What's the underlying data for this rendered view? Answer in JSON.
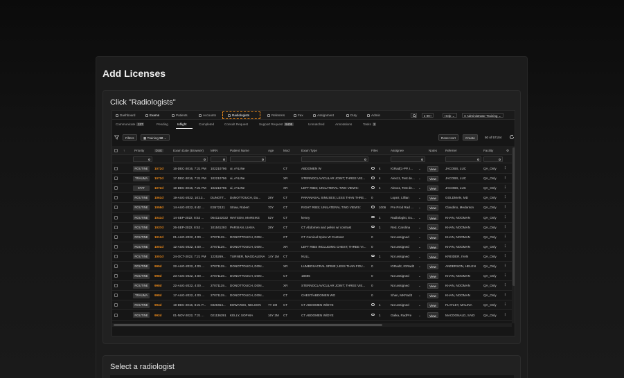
{
  "page": {
    "title": "Add Licenses",
    "step1_instruction": "Click \"Radiologists\"",
    "step2_instruction": "Select a radiologist"
  },
  "app": {
    "nav": [
      {
        "label": "Dashboard",
        "icon": "dashboard-icon"
      },
      {
        "label": "Exams",
        "icon": "exams-icon"
      },
      {
        "label": "Patients",
        "icon": "patients-icon"
      },
      {
        "label": "Accounts",
        "icon": "accounts-icon"
      },
      {
        "label": "Radiologists",
        "icon": "radiologists-icon"
      },
      {
        "label": "Referrers",
        "icon": "referrers-icon"
      },
      {
        "label": "Fax",
        "icon": "fax-icon"
      },
      {
        "label": "Assignment",
        "icon": "assignment-icon"
      },
      {
        "label": "Duty",
        "icon": "duty-icon"
      },
      {
        "label": "Admin",
        "icon": "admin-icon"
      }
    ],
    "notifications": "99+",
    "help_label": "Help",
    "user_label": "Administrator Training",
    "tabs": [
      {
        "label": "Communicate",
        "count": "137"
      },
      {
        "label": "Pending",
        "count": ""
      },
      {
        "label": "Inflight",
        "count": ""
      },
      {
        "label": "Completed",
        "count": ""
      },
      {
        "label": "Consult Request",
        "count": ""
      },
      {
        "label": "Support Request",
        "count": "9405"
      },
      {
        "label": "Unmatched",
        "count": ""
      },
      {
        "label": "Annotations",
        "count": ""
      },
      {
        "label": "Tasks",
        "count": "2"
      }
    ],
    "toolbar": {
      "filters_label": "Filters",
      "training_label": "Training",
      "training_count": "50",
      "reset_label": "Reset sort",
      "create_label": "Create",
      "paging": "50 of 57104"
    },
    "columns": [
      "Priority",
      "DUE",
      "Exam Date (Browser)",
      "MRN",
      "Patient Name",
      "Age",
      "Mod",
      "Exam Type",
      "Files",
      "Assignee",
      "Notes",
      "Referrer",
      "Facility"
    ],
    "rows": [
      {
        "priority": "ROUTINE",
        "due": "1072d",
        "date": "16-DEC-2016, 7:21 PM",
        "mrn": "102210796",
        "patient": "ui, AYLINe",
        "age": "",
        "mod": "CT",
        "exam": "ABDOMEN W",
        "files": "4",
        "assignee": "IGRad(1-PP, I...",
        "referrer": "JACOBS, LUC",
        "facility": "QA_Only"
      },
      {
        "priority": "TRAUMA",
        "due": "1072d",
        "date": "17-DEC-2016, 7:21 PM",
        "mrn": "102210796",
        "patient": "ui, AYLINe",
        "age": "",
        "mod": "XR",
        "exam": "STERNOCLAVICULAR JOINT; THREE VIE...",
        "files": "4",
        "assignee": "Alex11, Test de...",
        "referrer": "JACOBS, LUC",
        "facility": "QA_Only"
      },
      {
        "priority": "STAT",
        "due": "1072d",
        "date": "18-DEC-2016, 7:21 PM",
        "mrn": "102210796",
        "patient": "ui, AYLINe",
        "age": "",
        "mod": "XR",
        "exam": "LEFT RIBS; UNILATERAL TWO VIEWS:",
        "files": "4",
        "assignee": "Alex11, Test de...",
        "referrer": "JACOBS, LUC",
        "facility": "QA_Only"
      },
      {
        "priority": "ROUTINE",
        "due": "1061d",
        "date": "19-AUG-2022, 10:13...",
        "mrn": "DUNOTT...",
        "patient": "DoNOTTOUCH, Du...",
        "age": "28Y",
        "mod": "CT",
        "exam": "PARANASAL SINUSES; LESS THAN THRE...",
        "files": "0",
        "assignee": "Lopez, Lillian",
        "referrer": "GOLDMAN, MD",
        "facility": "QA_Only"
      },
      {
        "priority": "ROUTINE",
        "due": "1058d",
        "date": "14-AUG-2022, 8:42 ...",
        "mrn": "E3572121",
        "patient": "Straw, Robert",
        "age": "70Y",
        "mod": "CT",
        "exam": "RIGHT RIBS; UNILATERAL TWO VIEWS:",
        "files": "1006",
        "assignee": "Pre Prod Rad ...",
        "referrer": "Claudino, Medarson",
        "facility": "QA_Only"
      },
      {
        "priority": "ROUTINE",
        "due": "1041d",
        "date": "14-SEP-2022, 8:52 ...",
        "mrn": "0641142022",
        "patient": "WATSON, MAREIKE",
        "age": "52Y",
        "mod": "CT",
        "exam": "kenny",
        "files": "1",
        "assignee": "Radiologist, Eu...",
        "referrer": "KHAN, NOOMAN",
        "facility": "QA_Only"
      },
      {
        "priority": "ROUTINE",
        "due": "1037d",
        "date": "26-SEP-2022, 8:52 ...",
        "mrn": "101541293",
        "patient": "PARSIAN, LIANA",
        "age": "28Y",
        "mod": "CT",
        "exam": "CT Abdomen and pelvis w/ contrast",
        "files": "1",
        "assignee": "Red, Carolina",
        "referrer": "KHAN, NOOMAN",
        "facility": "QA_Only"
      },
      {
        "priority": "ROUTINE",
        "due": "1012d",
        "date": "01-AUG-2022, 4:00 ...",
        "mrn": "27071119...",
        "patient": "DONOTTOUCH, DON...",
        "age": "",
        "mod": "CT",
        "exam": "CT Cervical Spine W Contrast",
        "files": "0",
        "assignee": "Not assigned",
        "referrer": "KHAN, NOOMAN",
        "facility": "QA_Only"
      },
      {
        "priority": "ROUTINE",
        "due": "1001d",
        "date": "12-AUG-2022, 4:00 ...",
        "mrn": "27071119...",
        "patient": "DONOTTOUCH, DON...",
        "age": "",
        "mod": "XR",
        "exam": "LEFT RIBS INCLUDING CHEST; THREE VI...",
        "files": "0",
        "assignee": "Not assigned",
        "referrer": "KHAN, NOOMAN",
        "facility": "QA_Only"
      },
      {
        "priority": "ROUTINE",
        "due": "1001d",
        "date": "24-OCT-2022, 7:21 PM",
        "mrn": "1225269...",
        "patient": "TURNER, MAGDALENA",
        "age": "14Y 1M",
        "mod": "CT",
        "exam": "NULL",
        "files": "1",
        "assignee": "Not assigned",
        "referrer": "KREIDER, IVAN",
        "facility": "QA_Only"
      },
      {
        "priority": "ROUTINE",
        "due": "999d",
        "date": "22-AUG-2022, 4:00 ...",
        "mrn": "27071119...",
        "patient": "DONOTTOUCH, DON...",
        "age": "",
        "mod": "XR",
        "exam": "LUMBOSACRAL SPINE; LESS THAN FOU...",
        "files": "0",
        "assignee": "IGRad2, IGRad2",
        "referrer": "ANDERSON, HELEN",
        "facility": "QA_Only"
      },
      {
        "priority": "ROUTINE",
        "due": "998d",
        "date": "23-AUG-2022, 4:00 ...",
        "mrn": "27071119...",
        "patient": "DONOTTOUCH, DON...",
        "age": "",
        "mod": "CT",
        "exam": "18696",
        "files": "0",
        "assignee": "Not assigned",
        "referrer": "KHAN, NOOMAN",
        "facility": "QA_Only"
      },
      {
        "priority": "ROUTINE",
        "due": "998d",
        "date": "22-AUG-2022, 4:00 ...",
        "mrn": "27071119...",
        "patient": "DONOTTOUCH, DON...",
        "age": "",
        "mod": "XR",
        "exam": "STERNOCLAVICULAR JOINT; THREE VIE...",
        "files": "0",
        "assignee": "Not assigned",
        "referrer": "KHAN, NOOMAN",
        "facility": "QA_Only"
      },
      {
        "priority": "TRAUMA",
        "due": "998d",
        "date": "17-AUG-2022, 4:00 ...",
        "mrn": "27071119...",
        "patient": "DONOTTOUCH, DON...",
        "age": "",
        "mod": "CT",
        "exam": "CHEST/ABDOMEN WO",
        "files": "0",
        "assignee": "Shan, MKRad3",
        "referrer": "KHAN, NOOMAN",
        "facility": "QA_Only"
      },
      {
        "priority": "ROUTINE",
        "due": "994d",
        "date": "19-DEC-2016, 8:21 P...",
        "mrn": "0329454...",
        "patient": "EDWARDS, NELSON",
        "age": "7Y 2M",
        "mod": "CT",
        "exam": "CT ABDOMEN W/DYE",
        "files": "1",
        "assignee": "Not assigned",
        "referrer": "FLATLEY, MALINA",
        "facility": "QA_Only"
      },
      {
        "priority": "ROUTINE",
        "due": "992d",
        "date": "01-NOV-2022, 7:21 ...",
        "mrn": "021136391",
        "patient": "KELLY, SOPHIA",
        "age": "16Y 2M",
        "mod": "CT",
        "exam": "CT ABDOMEN W/DYE",
        "files": "1",
        "assignee": "Galka, RadPre",
        "referrer": "MACDONALD, SAID",
        "facility": "QA_Only"
      }
    ],
    "view_label": "View"
  },
  "colors": {
    "accent": "#f08c1a",
    "background": "#0f0f0f",
    "panel": "#1c1c1c"
  }
}
